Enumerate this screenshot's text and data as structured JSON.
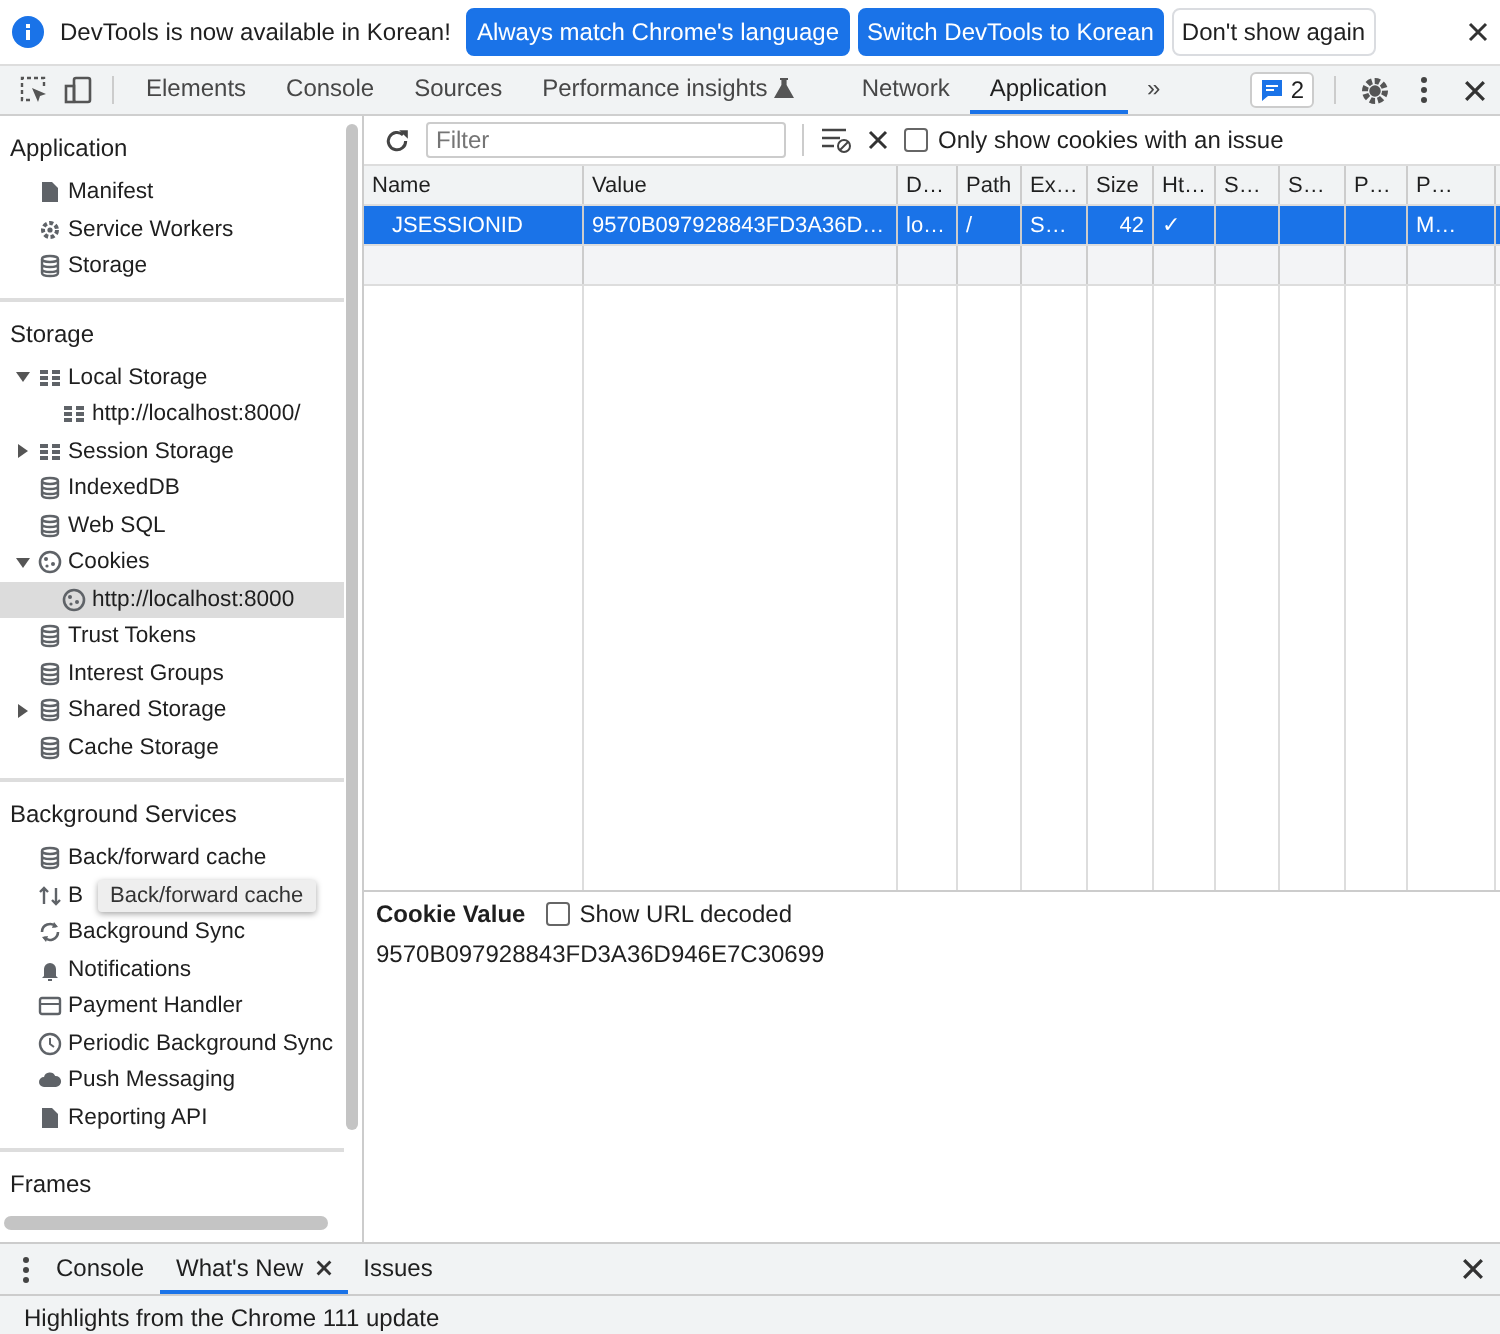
{
  "infobar": {
    "message": "DevTools is now available in Korean!",
    "buttons": [
      {
        "label": "Always match Chrome's language",
        "kind": "primary"
      },
      {
        "label": "Switch DevTools to Korean",
        "kind": "primary"
      },
      {
        "label": "Don't show again",
        "kind": "plain"
      }
    ]
  },
  "tabs": [
    {
      "label": "Elements",
      "selected": false
    },
    {
      "label": "Console",
      "selected": false
    },
    {
      "label": "Sources",
      "selected": false
    },
    {
      "label": "Performance insights",
      "selected": false,
      "experimental": true
    },
    {
      "label": "Network",
      "selected": false
    },
    {
      "label": "Application",
      "selected": true
    }
  ],
  "more_tabs": "»",
  "issues_count": "2",
  "sidebar": {
    "sections": [
      {
        "title": "Application",
        "items": [
          {
            "label": "Manifest",
            "kind": "file",
            "selected": false
          },
          {
            "label": "Service Workers",
            "kind": "gear",
            "selected": false
          },
          {
            "label": "Storage",
            "kind": "db",
            "selected": false
          }
        ]
      },
      {
        "title": "Storage",
        "items": [
          {
            "label": "Local Storage",
            "kind": "grid",
            "selected": false,
            "expanded": true,
            "children": [
              {
                "label": "http://localhost:8000/",
                "kind": "grid",
                "selected": false
              }
            ]
          },
          {
            "label": "Session Storage",
            "kind": "grid",
            "selected": false,
            "expanded": false
          },
          {
            "label": "IndexedDB",
            "kind": "db",
            "selected": false
          },
          {
            "label": "Web SQL",
            "kind": "db",
            "selected": false
          },
          {
            "label": "Cookies",
            "kind": "cookie",
            "selected": false,
            "expanded": true,
            "children": [
              {
                "label": "http://localhost:8000",
                "kind": "cookie",
                "selected": true
              }
            ]
          },
          {
            "label": "Trust Tokens",
            "kind": "db",
            "selected": false
          },
          {
            "label": "Interest Groups",
            "kind": "db",
            "selected": false
          },
          {
            "label": "Shared Storage",
            "kind": "db",
            "selected": false,
            "expanded": false
          },
          {
            "label": "Cache Storage",
            "kind": "db",
            "selected": false
          }
        ]
      },
      {
        "title": "Background Services",
        "items": [
          {
            "label": "Back/forward cache",
            "kind": "db",
            "selected": false
          },
          {
            "label": "B",
            "kind": "updown",
            "selected": false,
            "tooltip": "Back/forward cache"
          },
          {
            "label": "Background Sync",
            "kind": "sync",
            "selected": false
          },
          {
            "label": "Notifications",
            "kind": "bell",
            "selected": false
          },
          {
            "label": "Payment Handler",
            "kind": "card",
            "selected": false
          },
          {
            "label": "Periodic Background Sync",
            "kind": "clock",
            "selected": false
          },
          {
            "label": "Push Messaging",
            "kind": "cloud",
            "selected": false
          },
          {
            "label": "Reporting API",
            "kind": "file",
            "selected": false
          }
        ]
      },
      {
        "title": "Frames"
      }
    ]
  },
  "filter": {
    "placeholder": "Filter",
    "only_issues": {
      "label": "Only show cookies with an issue",
      "checked": false
    }
  },
  "table": {
    "columns": [
      "Name",
      "Value",
      "D…",
      "Path",
      "Ex…",
      "Size",
      "Ht…",
      "S…",
      "S…",
      "P…",
      "P…"
    ],
    "rows": [
      {
        "selected": true,
        "cells": [
          "JSESSIONID",
          "9570B097928843FD3A36D…",
          "lo…",
          "/",
          "S…",
          "42",
          "✓",
          null,
          null,
          null,
          "M…"
        ]
      }
    ]
  },
  "cookie_value": {
    "title": "Cookie Value",
    "decode": {
      "label": "Show URL decoded",
      "checked": false
    },
    "value": "9570B097928843FD3A36D946E7C30699"
  },
  "drawer": {
    "tabs": [
      {
        "label": "Console",
        "selected": false,
        "closable": false
      },
      {
        "label": "What's New",
        "selected": true,
        "closable": true
      },
      {
        "label": "Issues",
        "selected": false,
        "closable": false
      }
    ],
    "content": "Highlights from the Chrome 111 update"
  }
}
